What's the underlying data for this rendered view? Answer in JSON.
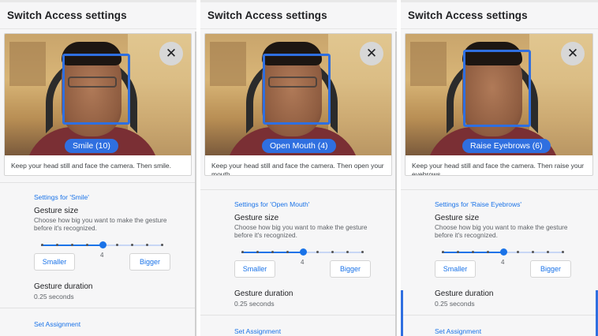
{
  "panels": [
    {
      "title": "Switch Access settings",
      "gesture_label": "Smile (10)",
      "instructions": "Keep your head still and face the camera. Then smile.",
      "settings_link": "Settings for 'Smile'",
      "gesture_size_title": "Gesture size",
      "gesture_size_desc": "Choose how big you want to make the gesture before it's recognized.",
      "slider_value": "4",
      "slider_level": 0.5,
      "smaller_label": "Smaller",
      "bigger_label": "Bigger",
      "duration_title": "Gesture duration",
      "duration_value": "0.25 seconds",
      "assignment_label": "Set Assignment"
    },
    {
      "title": "Switch Access settings",
      "gesture_label": "Open Mouth (4)",
      "instructions": "Keep your head still and face the camera. Then open your mouth.",
      "settings_link": "Settings for 'Open Mouth'",
      "gesture_size_title": "Gesture size",
      "gesture_size_desc": "Choose how big you want to make the gesture before it's recognized.",
      "slider_value": "4",
      "slider_level": 0.5,
      "smaller_label": "Smaller",
      "bigger_label": "Bigger",
      "duration_title": "Gesture duration",
      "duration_value": "0.25 seconds",
      "assignment_label": "Set Assignment"
    },
    {
      "title": "Switch Access settings",
      "gesture_label": "Raise Eyebrows (6)",
      "instructions": "Keep your head still and face the camera. Then raise your eyebrows.",
      "settings_link": "Settings for 'Raise Eyebrows'",
      "gesture_size_title": "Gesture size",
      "gesture_size_desc": "Choose how big you want to make the gesture before it's recognized.",
      "slider_value": "4",
      "slider_level": 0.5,
      "smaller_label": "Smaller",
      "bigger_label": "Bigger",
      "duration_title": "Gesture duration",
      "duration_value": "0.25 seconds",
      "assignment_label": "Set Assignment"
    }
  ],
  "icons": {
    "close": "close-icon"
  },
  "colors": {
    "accent": "#2f6fe0",
    "link": "#1a73e8",
    "background": "#f6f6f7"
  }
}
